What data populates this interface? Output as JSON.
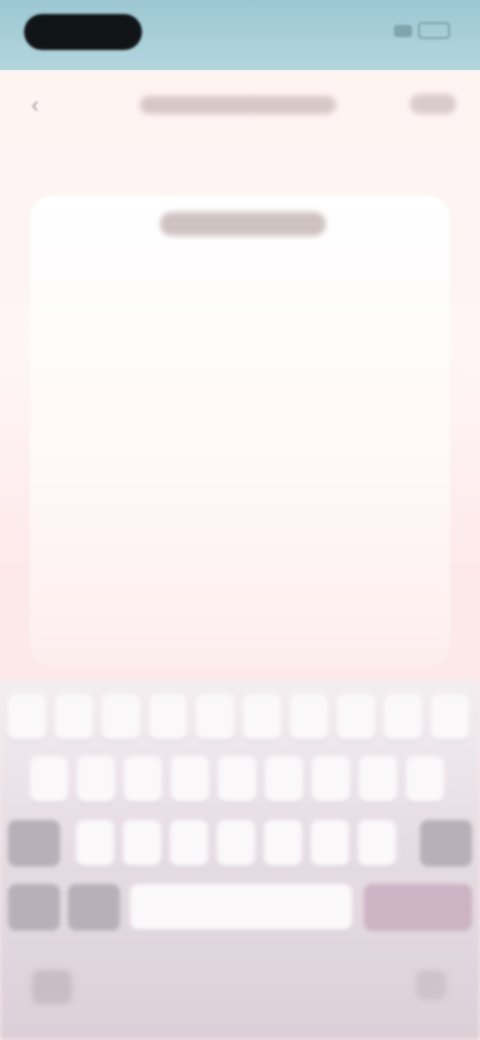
{
  "status_bar": {
    "time": "",
    "signal_icon": "signal-icon",
    "battery_icon": "battery-icon"
  },
  "nav": {
    "back_icon": "back-arrow-icon",
    "title": "",
    "action_label": ""
  },
  "card": {
    "title": "",
    "text_value": ""
  },
  "keyboard": {
    "space_label": ""
  },
  "colors": {
    "status_bar": "#9cc7d2",
    "page_background": "#fdf3f1",
    "keyboard_background": "#e6dde3"
  }
}
